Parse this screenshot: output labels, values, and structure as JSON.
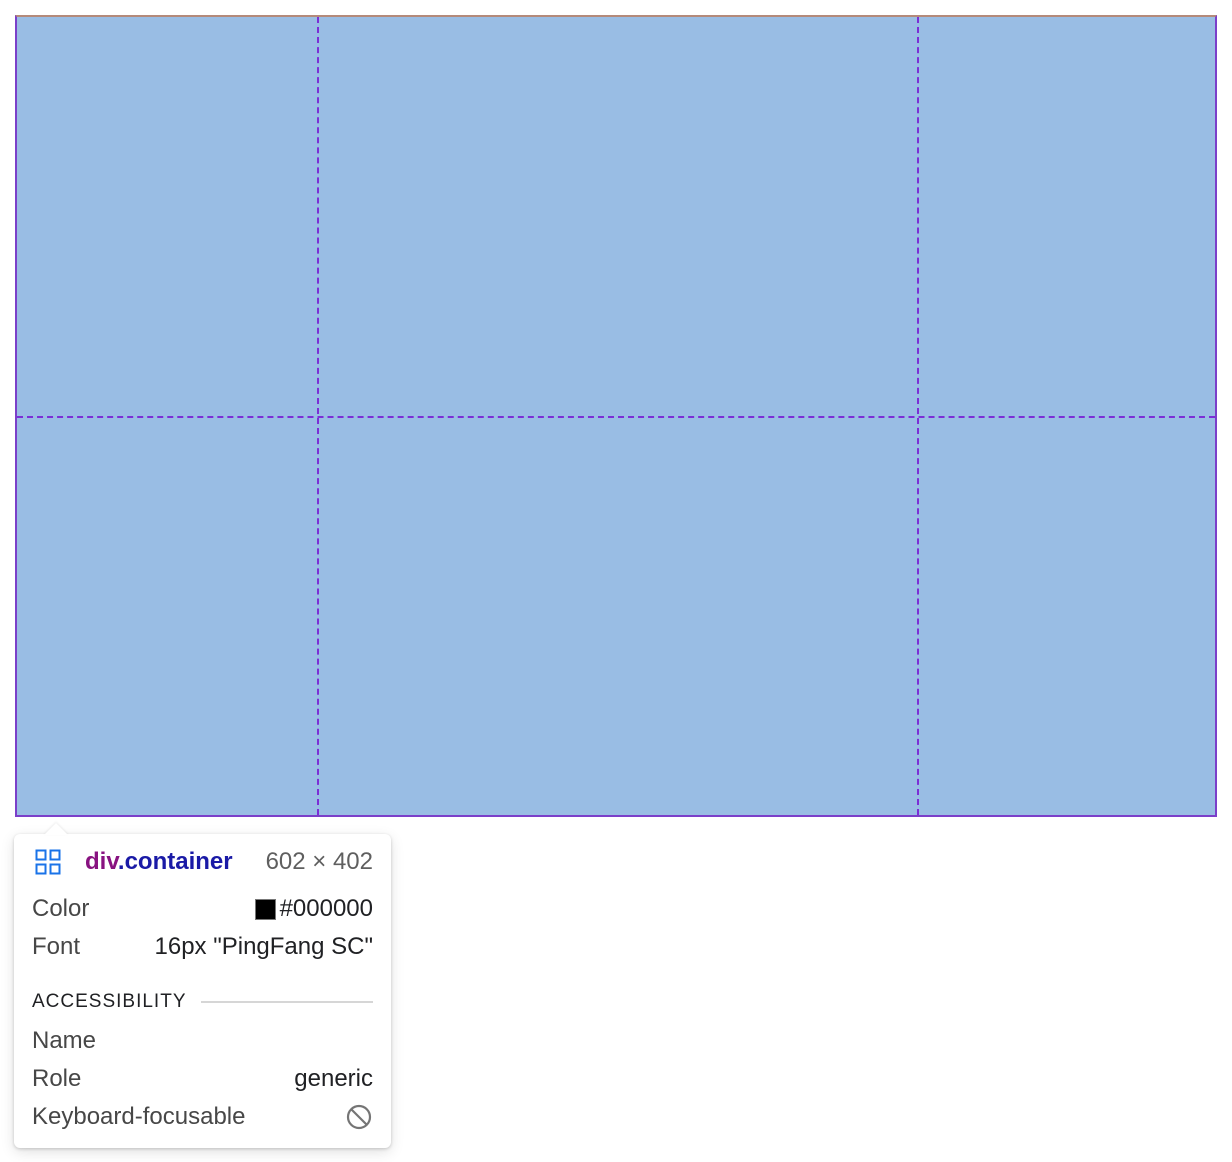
{
  "tooltip": {
    "element_tag": "div",
    "element_class": ".container",
    "element_size": "602 × 402",
    "rows": {
      "color_label": "Color",
      "color_value": "#000000",
      "font_label": "Font",
      "font_value": "16px \"PingFang SC\""
    },
    "accessibility": {
      "section_title": "ACCESSIBILITY",
      "name_label": "Name",
      "name_value": "",
      "role_label": "Role",
      "role_value": "generic",
      "focusable_label": "Keyboard-focusable"
    },
    "icons": {
      "grid": "grid-layout-icon",
      "not_focusable": "no-entry-icon"
    }
  },
  "colors": {
    "grid_fill": "#99bde4",
    "grid_lines": "#7b2fd6",
    "tag_color": "#881280",
    "class_color": "#1a1aa6",
    "swatch": "#000000"
  }
}
